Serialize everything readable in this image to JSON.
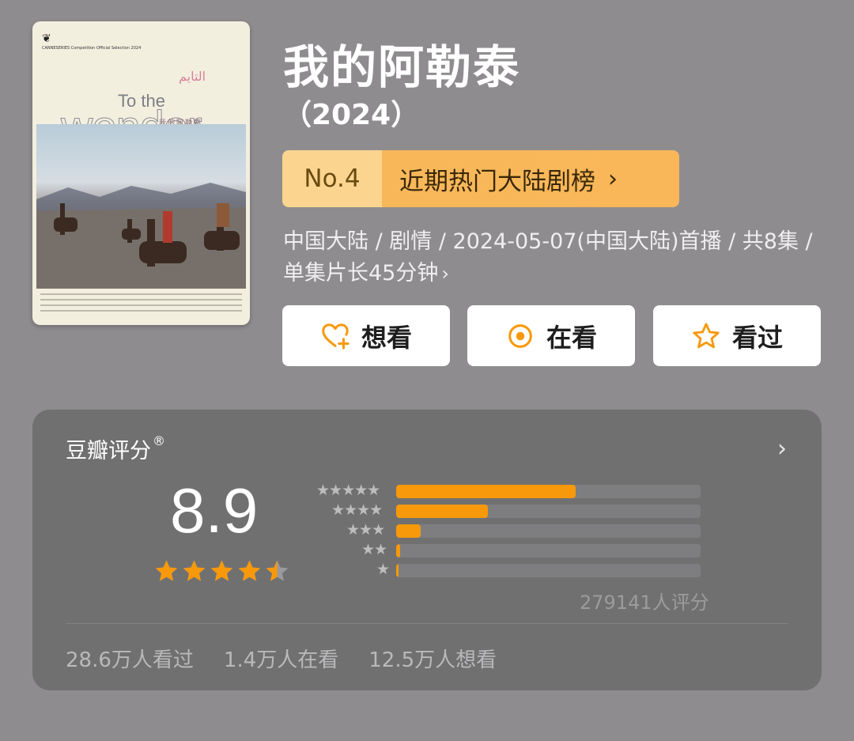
{
  "poster": {
    "festival_text": "CANNESERIES Competition Official Selection 2024",
    "arabic_text": "التايم",
    "en_title_1": "To the",
    "en_title_2": "wonder",
    "cn_title": "我的阿勒泰"
  },
  "show": {
    "title": "我的阿勒泰",
    "year": "（2024）",
    "rank_no": "No.4",
    "rank_list": "近期热门大陆剧榜",
    "rank_chevron": "›",
    "meta": "中国大陆 / 剧情 / 2024-05-07(中国大陆)首播 / 共8集 / 单集片长45分钟",
    "meta_chevron": "›"
  },
  "actions": {
    "want_label": "想看",
    "watching_label": "在看",
    "watched_label": "看过",
    "accent_color": "#f7990b"
  },
  "rating": {
    "header": "豆瓣评分",
    "registered": "®",
    "arrow": "›",
    "score": "8.9",
    "stars_value": 4.5,
    "distribution": [
      {
        "stars": "★★★★★",
        "fraction": 0.59
      },
      {
        "stars": "★★★★",
        "fraction": 0.3
      },
      {
        "stars": "★★★",
        "fraction": 0.08
      },
      {
        "stars": "★★",
        "fraction": 0.012
      },
      {
        "stars": "★",
        "fraction": 0.006
      }
    ],
    "count": "279141人评分",
    "stats": [
      "28.6万人看过",
      "1.4万人在看",
      "12.5万人想看"
    ]
  }
}
